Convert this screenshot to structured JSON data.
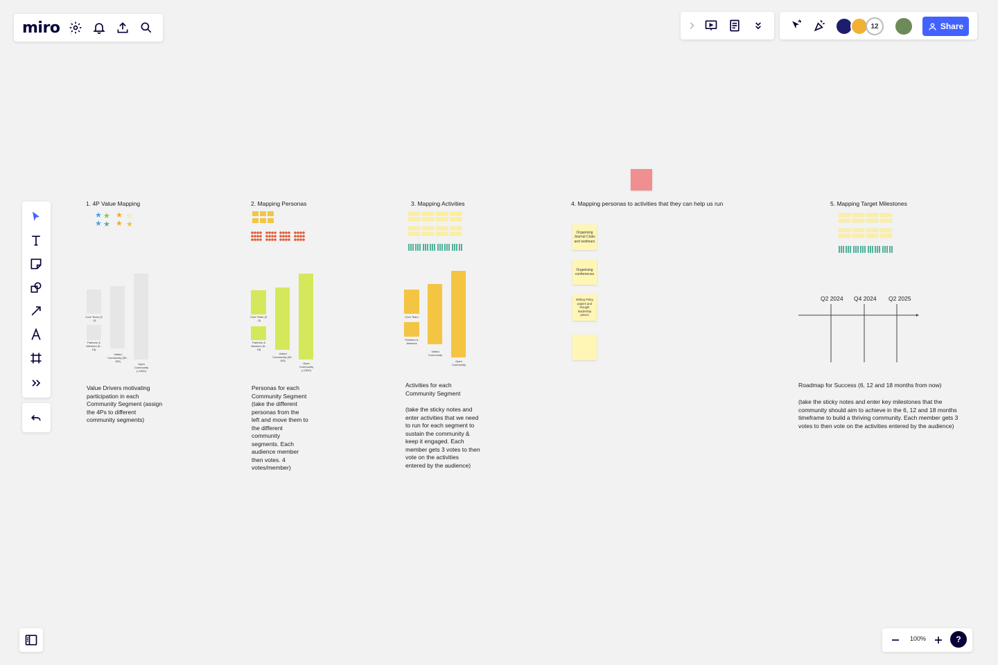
{
  "app": {
    "logo": "miro"
  },
  "topbar_right": {
    "collaborator_count": "12",
    "share_label": "Share"
  },
  "zoom": {
    "level": "100%",
    "help": "?"
  },
  "sections": {
    "s1": {
      "title": "1. 4P Value Mapping",
      "desc": "Value Drivers motivating participation  in each  Community Segment (assign the 4Ps to different community segments)"
    },
    "s2": {
      "title": "2. Mapping Personas",
      "desc": "Personas for each Community Segment (take the different personas from the left and move them to the different community segments.  Each audience member then votes. 4 votes/member)"
    },
    "s3": {
      "title": "3. Mapping Activities",
      "desc_a": "Activities for each Community Segment",
      "desc_b": "(take the sticky notes and enter activities that we need to run for each segment to sustain the community & keep it engaged. Each member gets 3 votes to then vote on the activities entered by the audience)"
    },
    "s4": {
      "title": "4. Mapping personas to activities that they can help us run",
      "stickies": [
        "Organising Journal Clubs and webinars",
        "Organising conferences",
        "Writing Policy papers and thought leadership pieces",
        ""
      ]
    },
    "s5": {
      "title": "5. Mapping Target Milestones",
      "milestones": [
        "Q2 2024",
        "Q4 2024",
        "Q2 2025"
      ],
      "desc_a": "Roadmap for Success (6, 12 and 18 months from now)",
      "desc_b": "(take the sticky notes and enter key milestones that the community should aim to achieve in the 6, 12 and 18 months timeframe to build a thriving community. Each member gets 3 votes to then vote on the activities entered by the audience)"
    }
  },
  "bar_labels": {
    "core": "Core Team (3 - 5)",
    "partners": "Partners & Advisors (5 - 15)",
    "vetted": "Vetted Community (50 - 150)",
    "open": "Open Community (>1500)",
    "core_short": "Core Team",
    "partners_short": "Partners & Advisors",
    "vetted_short": "Vetted Community",
    "open_short": "Open Community"
  },
  "colors": {
    "accent": "#4262ff",
    "gray_bar": "#e6e6e6",
    "green_bar": "#d5e85c",
    "yellow_bar": "#f4c542",
    "sticky": "#fff6b6",
    "red_dot": "#e5572f",
    "teal_icon": "#4fb09a"
  }
}
